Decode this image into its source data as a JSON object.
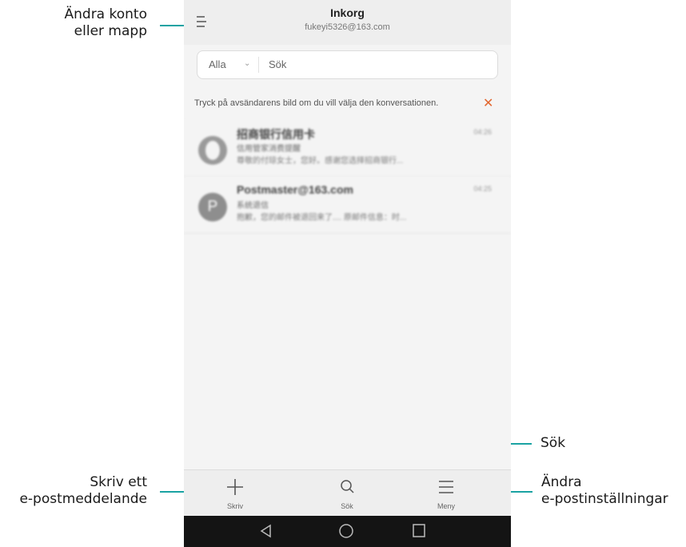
{
  "callouts": {
    "account": {
      "line1": "Ändra konto",
      "line2": "eller mapp"
    },
    "compose": {
      "line1": "Skriv ett",
      "line2": "e-postmeddelande"
    },
    "search": {
      "line1": "Sök"
    },
    "settings": {
      "line1": "Ändra",
      "line2": "e-postinställningar"
    }
  },
  "header": {
    "menu_icon": "menu-icon",
    "title": "Inkorg",
    "account": "fukeyi5326@163.com"
  },
  "search": {
    "filter": "Alla",
    "placeholder": "Sök"
  },
  "tip": {
    "text": "Tryck på avsändarens bild om du vill välja den konversationen.",
    "close_icon": "close-icon"
  },
  "messages": [
    {
      "avatar_letter": "",
      "sender": "招商银行信用卡",
      "time": "04:26",
      "subject": "信用管家消费提醒",
      "preview": "尊敬的付琼女士，您好。感谢您选择招商银行..."
    },
    {
      "avatar_letter": "P",
      "sender": "Postmaster@163.com",
      "time": "04:25",
      "subject": "系统退信",
      "preview": "抱歉，您的邮件被退回来了.... 原邮件信息：时..."
    }
  ],
  "bottombar": {
    "compose": "Skriv",
    "search": "Sök",
    "menu": "Meny"
  },
  "colors": {
    "accent": "#1aa3a3",
    "close": "#e2672f"
  }
}
